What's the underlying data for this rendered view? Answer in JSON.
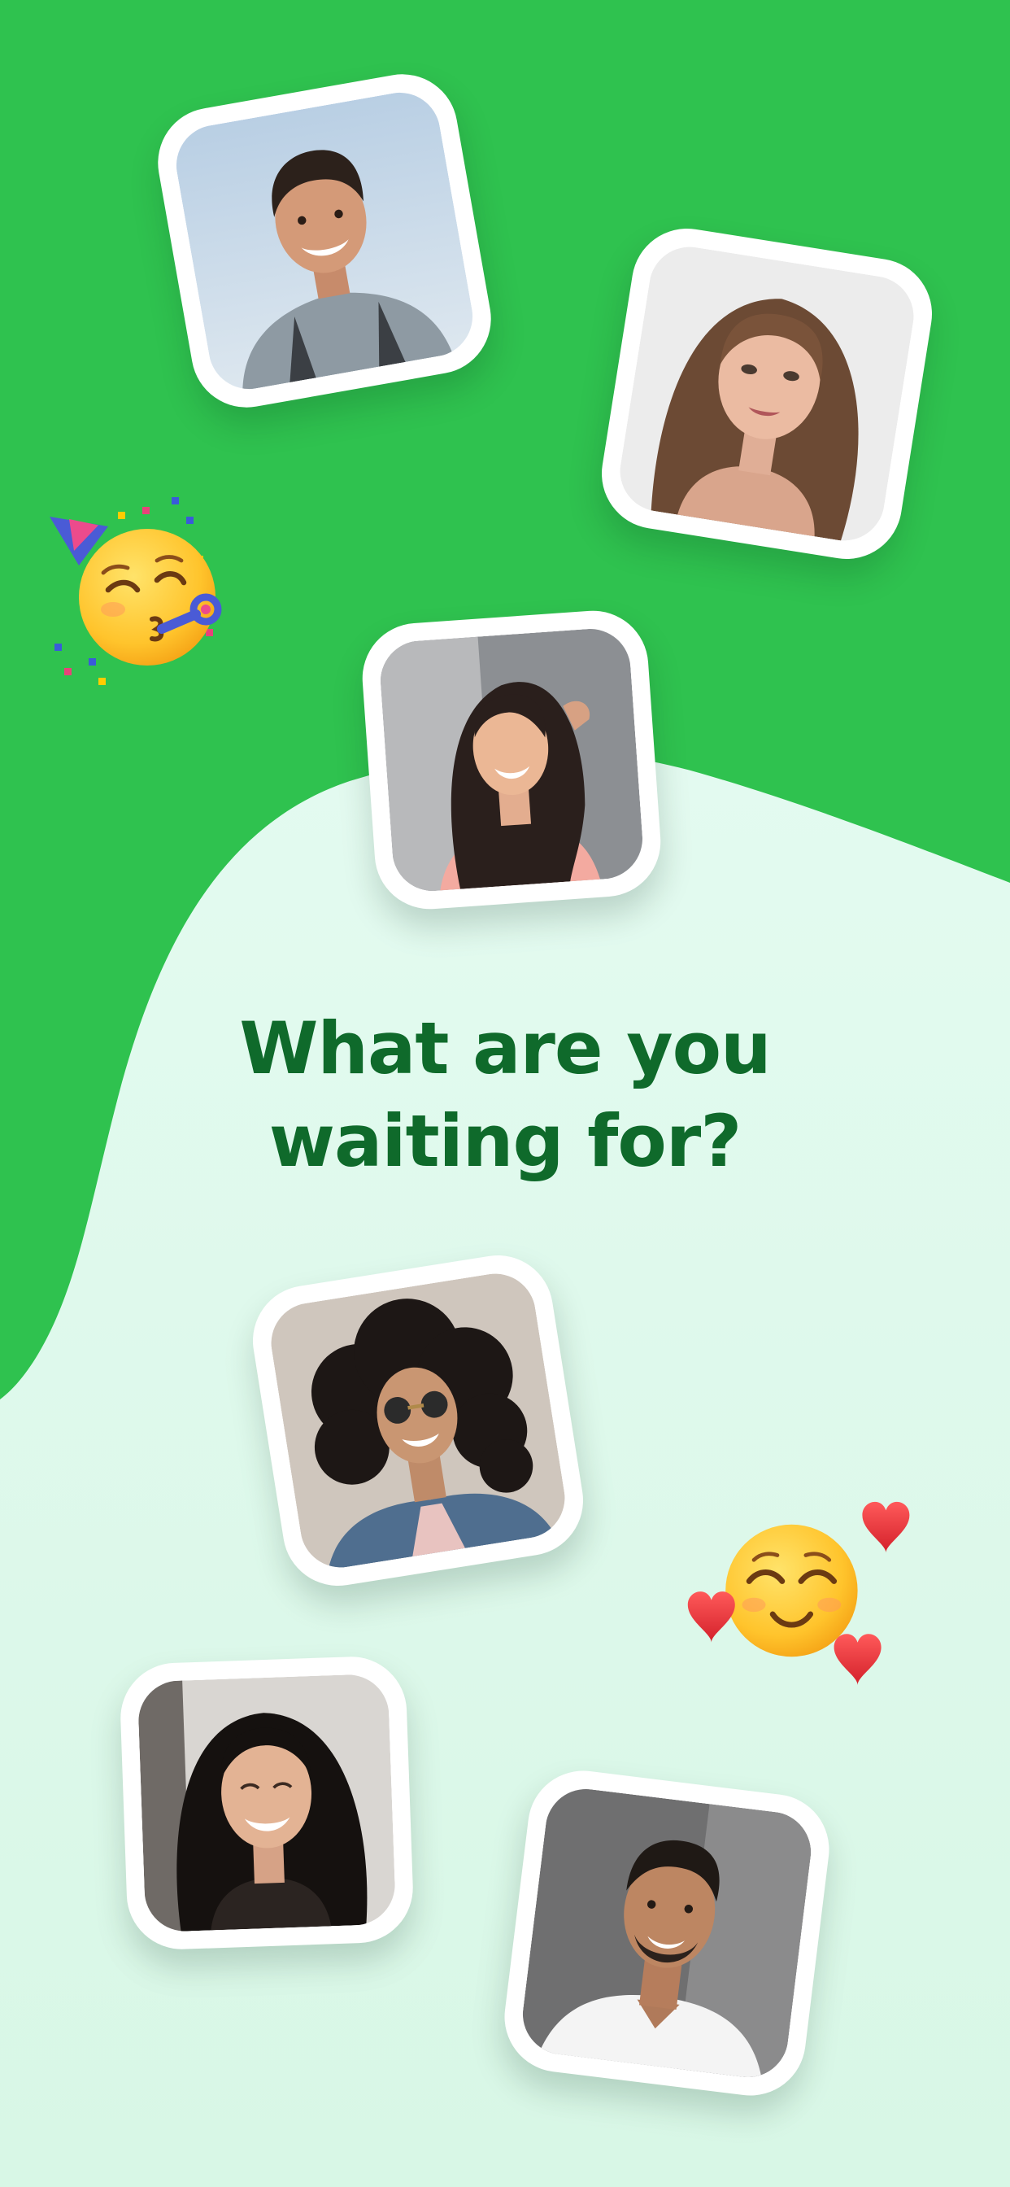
{
  "screen": {
    "headline_line1": "What are you",
    "headline_line2": "waiting for?"
  },
  "colors": {
    "brand_green": "#2fc24f",
    "light_mint": "#e1faf0",
    "headline_green": "#0f6a2b",
    "card_white": "#ffffff"
  },
  "cards": [
    {
      "name": "profile-card-smiling-man-outdoors"
    },
    {
      "name": "profile-card-woman-brown-hair"
    },
    {
      "name": "profile-card-woman-laughing-dark-hair"
    },
    {
      "name": "profile-card-woman-curly-hair-sunglasses"
    },
    {
      "name": "profile-card-woman-smiling-long-hair"
    },
    {
      "name": "profile-card-man-white-tshirt"
    }
  ],
  "emojis": [
    {
      "name": "partying-face-emoji"
    },
    {
      "name": "smiling-face-with-hearts-emoji"
    }
  ]
}
